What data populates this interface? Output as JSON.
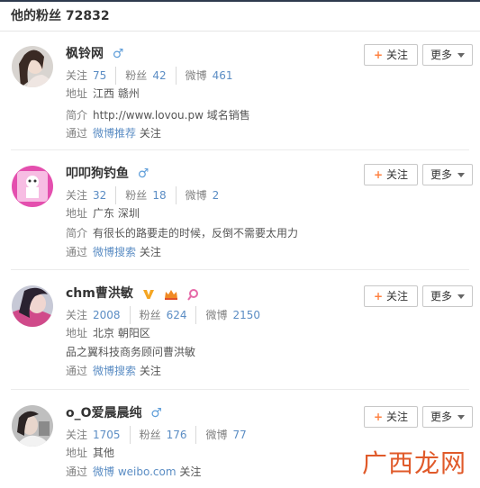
{
  "page": {
    "title": "他的粉丝 72832"
  },
  "buttons": {
    "follow": "关注",
    "more": "更多"
  },
  "labels": {
    "following": "关注",
    "fans": "粉丝",
    "weibo": "微博",
    "address": "地址",
    "intro": "简介",
    "via": "通过",
    "follow_suffix": "关注"
  },
  "fans": [
    {
      "name": "枫铃网",
      "gender": "♂",
      "following": "75",
      "fans": "42",
      "weibo": "461",
      "address": "江西 赣州",
      "intro": "http://www.lovou.pw 域名销售",
      "via": "微博推荐"
    },
    {
      "name": "叩叩狗钓鱼",
      "gender": "♂",
      "following": "32",
      "fans": "18",
      "weibo": "2",
      "address": "广东 深圳",
      "intro": "有很长的路要走的时候，反倒不需要太用力",
      "via": "微博搜索"
    },
    {
      "name": "chm曹洪敏",
      "following": "2008",
      "fans": "624",
      "weibo": "2150",
      "address": "北京 朝阳区",
      "bio": "品之翼科技商务顾问曹洪敏",
      "via": "微博搜索"
    },
    {
      "name": "o_O爱晨晨纯",
      "gender": "♂",
      "following": "1705",
      "fans": "176",
      "weibo": "77",
      "address": "其他",
      "via": "微博 weibo.com"
    }
  ],
  "watermark": "广西龙网",
  "colors": {
    "link": "#5b8dc4",
    "plus": "#ff8140",
    "gender": "#5f9ed9",
    "verified": "#f5a623"
  },
  "icons": {
    "gender": "male-icon",
    "verified": "verified-v-icon",
    "vip": "vip-crown-icon",
    "club": "club-icon"
  }
}
